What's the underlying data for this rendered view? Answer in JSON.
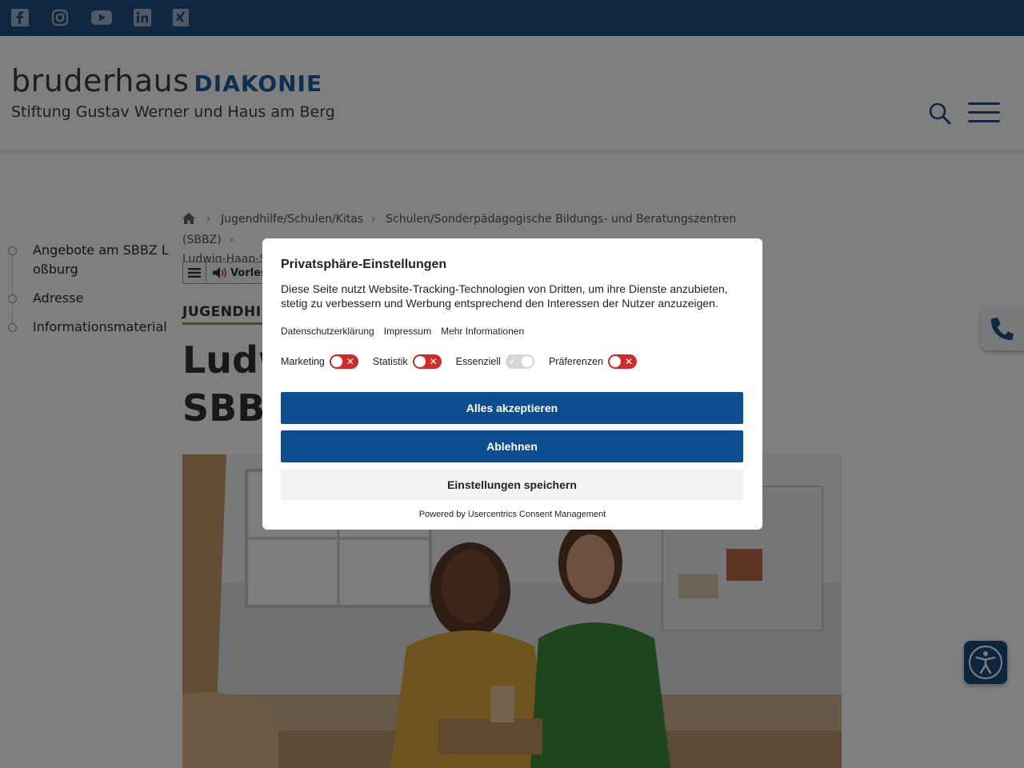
{
  "social": {
    "icons": [
      "facebook-icon",
      "instagram-icon",
      "youtube-icon",
      "linkedin-icon",
      "xing-icon"
    ]
  },
  "header": {
    "logo_word1": "bruderhaus",
    "logo_word2": "DIAKONIE",
    "logo_subtitle": "Stiftung Gustav Werner und Haus am Berg"
  },
  "breadcrumb": {
    "items": [
      "Jugendhilfe/Schulen/Kitas",
      "Schulen/Sonderpädagogische Bildungs- und Beratungszentren (SBBZ)",
      "Ludwig-Haap-Schule Loßburg - SBBZ ESENT"
    ]
  },
  "sidenav": {
    "items": [
      {
        "label": "Angebote am SBBZ Loßburg"
      },
      {
        "label": "Adresse"
      },
      {
        "label": "Informationsmaterial"
      }
    ]
  },
  "toolbar": {
    "read_label": "Vorles"
  },
  "main": {
    "section_label": "JUGENDHIL",
    "title_line1": "Ludw",
    "title_line2": "SBBZ"
  },
  "consent": {
    "title": "Privatsphäre-Einstellungen",
    "text": "Diese Seite nutzt Website-Tracking-Technologien von Dritten, um ihre Dienste anzubieten, stetig zu verbessern und Werbung entsprechend den Interessen der Nutzer anzuzeigen.",
    "links": [
      "Datenschutzerklärung",
      "Impressum",
      "Mehr Informationen"
    ],
    "toggles": [
      {
        "label": "Marketing",
        "enabled": false
      },
      {
        "label": "Statistik",
        "enabled": false
      },
      {
        "label": "Essenziell",
        "enabled": true
      },
      {
        "label": "Präferenzen",
        "enabled": false
      }
    ],
    "accept_all": "Alles akzeptieren",
    "reject": "Ablehnen",
    "save": "Einstellungen speichern",
    "powered_by": "Powered by Usercentrics Consent Management"
  },
  "colors": {
    "topbar": "#1e4f80",
    "brand_blue": "#1e5fa3",
    "accent_green": "#7aa53b",
    "button_primary": "#0b4d8f",
    "toggle_off": "#d02b2b"
  }
}
